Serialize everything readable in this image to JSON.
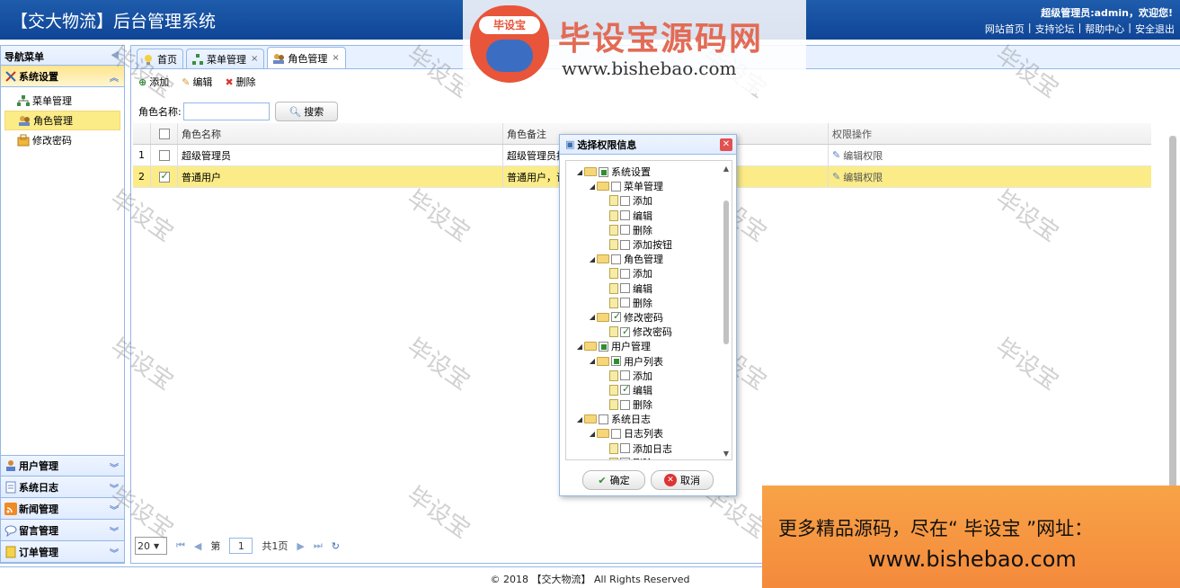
{
  "header": {
    "title": "【交大物流】后台管理系统",
    "welcome": "超级管理员:admin，欢迎您!",
    "links": [
      "网站首页",
      "|",
      "支持论坛",
      "|",
      "帮助中心",
      "|",
      "安全退出"
    ]
  },
  "nav": {
    "title": "导航菜单",
    "active_section": "系统设置",
    "items": [
      "菜单管理",
      "角色管理",
      "修改密码"
    ],
    "sections": [
      "用户管理",
      "系统日志",
      "新闻管理",
      "留言管理",
      "订单管理"
    ]
  },
  "tabs": [
    "首页",
    "菜单管理",
    "角色管理"
  ],
  "toolbar": {
    "add": "添加",
    "edit": "编辑",
    "delete": "删除"
  },
  "search": {
    "label": "角色名称:",
    "button": "搜索"
  },
  "grid": {
    "columns": [
      "角色名称",
      "角色备注",
      "权限操作"
    ],
    "rows": [
      {
        "num": "1",
        "name": "超级管理员",
        "remark": "超级管理员拥",
        "op": "编辑权限",
        "checked": false
      },
      {
        "num": "2",
        "name": "普通用户",
        "remark": "普通用户，该",
        "op": "编辑权限",
        "checked": true
      }
    ]
  },
  "pager": {
    "page_size": "20",
    "page_label": "第",
    "page": "1",
    "total": "共1页"
  },
  "dialog": {
    "title": "选择权限信息",
    "ok": "确定",
    "cancel": "取消",
    "tree": [
      {
        "label": "系统设置",
        "level": 0,
        "type": "folder",
        "state": "partial"
      },
      {
        "label": "菜单管理",
        "level": 1,
        "type": "folder",
        "state": "none"
      },
      {
        "label": "添加",
        "level": 2,
        "type": "file",
        "state": "none"
      },
      {
        "label": "编辑",
        "level": 2,
        "type": "file",
        "state": "none"
      },
      {
        "label": "删除",
        "level": 2,
        "type": "file",
        "state": "none"
      },
      {
        "label": "添加按钮",
        "level": 2,
        "type": "file",
        "state": "none"
      },
      {
        "label": "角色管理",
        "level": 1,
        "type": "folder",
        "state": "none"
      },
      {
        "label": "添加",
        "level": 2,
        "type": "file",
        "state": "none"
      },
      {
        "label": "编辑",
        "level": 2,
        "type": "file",
        "state": "none"
      },
      {
        "label": "删除",
        "level": 2,
        "type": "file",
        "state": "none"
      },
      {
        "label": "修改密码",
        "level": 1,
        "type": "folder",
        "state": "checked"
      },
      {
        "label": "修改密码",
        "level": 2,
        "type": "file",
        "state": "checked"
      },
      {
        "label": "用户管理",
        "level": 0,
        "type": "folder",
        "state": "partial"
      },
      {
        "label": "用户列表",
        "level": 1,
        "type": "folder",
        "state": "partial"
      },
      {
        "label": "添加",
        "level": 2,
        "type": "file",
        "state": "none"
      },
      {
        "label": "编辑",
        "level": 2,
        "type": "file",
        "state": "checked"
      },
      {
        "label": "删除",
        "level": 2,
        "type": "file",
        "state": "none"
      },
      {
        "label": "系统日志",
        "level": 0,
        "type": "folder",
        "state": "none"
      },
      {
        "label": "日志列表",
        "level": 1,
        "type": "folder",
        "state": "none"
      },
      {
        "label": "添加日志",
        "level": 2,
        "type": "file",
        "state": "none"
      },
      {
        "label": "删除",
        "level": 2,
        "type": "file",
        "state": "none"
      }
    ]
  },
  "footer": "© 2018 【交大物流】 All Rights Reserved",
  "watermark": {
    "text": "毕设宝",
    "logo_text": "毕设宝源码网",
    "logo_url": "www.bishebao.com",
    "promo_line1": "更多精品源码，尽在“ 毕设宝 ”网址：",
    "promo_line2": "www.bishebao.com"
  }
}
